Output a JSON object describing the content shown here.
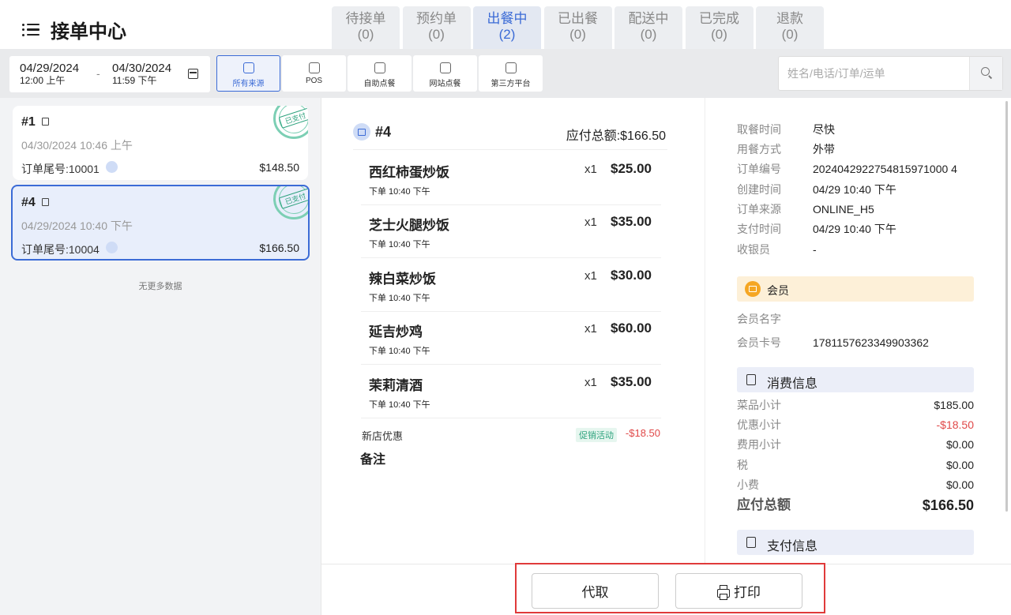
{
  "header": {
    "title": "接单中心",
    "tabs": [
      {
        "label": "待接单",
        "count": "(0)"
      },
      {
        "label": "预约单",
        "count": "(0)"
      },
      {
        "label": "出餐中",
        "count": "(2)"
      },
      {
        "label": "已出餐",
        "count": "(0)"
      },
      {
        "label": "配送中",
        "count": "(0)"
      },
      {
        "label": "已完成",
        "count": "(0)"
      },
      {
        "label": "退款",
        "count": "(0)"
      }
    ],
    "active_tab": "出餐中"
  },
  "filter": {
    "start_date": "04/29/2024",
    "start_time": "12:00 上午",
    "separator": "-",
    "end_date": "04/30/2024",
    "end_time": "11:59 下午",
    "sources": [
      "所有来源",
      "POS",
      "自助点餐",
      "网站点餐",
      "第三方平台"
    ],
    "active_source": "所有来源",
    "search_placeholder": "姓名/电话/订单/运单"
  },
  "orders": [
    {
      "num": "#1",
      "time": "04/30/2024 10:46 上午",
      "tail": "订单尾号:10001",
      "amount": "$148.50",
      "stamp": "已支付"
    },
    {
      "num": "#4",
      "time": "04/29/2024 10:40 下午",
      "tail": "订单尾号:10004",
      "amount": "$166.50",
      "stamp": "已支付"
    }
  ],
  "no_more": "无更多数据",
  "detail": {
    "num": "#4",
    "total": "应付总额:$166.50",
    "items": [
      {
        "name": "西红柿蛋炒饭",
        "time": "下单 10:40 下午",
        "qty": "x1",
        "price": "$25.00"
      },
      {
        "name": "芝士火腿炒饭",
        "time": "下单 10:40 下午",
        "qty": "x1",
        "price": "$35.00"
      },
      {
        "name": "辣白菜炒饭",
        "time": "下单 10:40 下午",
        "qty": "x1",
        "price": "$30.00"
      },
      {
        "name": "延吉炒鸡",
        "time": "下单 10:40 下午",
        "qty": "x1",
        "price": "$60.00"
      },
      {
        "name": "茉莉清酒",
        "time": "下单 10:40 下午",
        "qty": "x1",
        "price": "$35.00"
      }
    ],
    "promo_name": "新店优惠",
    "promo_tag": "促销活动",
    "promo_value": "-$18.50",
    "remark": "备注"
  },
  "info": {
    "fields": [
      {
        "k": "取餐时间",
        "v": "尽快"
      },
      {
        "k": "用餐方式",
        "v": "外带"
      },
      {
        "k": "订单编号",
        "v": "2024042922754815971000 4"
      },
      {
        "k": "创建时间",
        "v": "04/29 10:40 下午"
      },
      {
        "k": "订单来源",
        "v": "ONLINE_H5"
      },
      {
        "k": "支付时间",
        "v": "04/29 10:40 下午"
      },
      {
        "k": "收银员",
        "v": "-"
      }
    ],
    "member_title": "会员",
    "member_fields": [
      {
        "k": "会员名字",
        "v": ""
      },
      {
        "k": "会员卡号",
        "v": "1781157623349903362"
      }
    ],
    "consume_title": "消费信息",
    "consume_rows": [
      {
        "k": "菜品小计",
        "v": "$185.00"
      },
      {
        "k": "优惠小计",
        "v": "-$18.50"
      },
      {
        "k": "费用小计",
        "v": "$0.00"
      },
      {
        "k": "税",
        "v": "$0.00"
      },
      {
        "k": "小费",
        "v": "$0.00"
      }
    ],
    "payable_label": "应付总额",
    "payable_value": "$166.50",
    "pay_title": "支付信息"
  },
  "actions": {
    "pickup_label": "代取",
    "print_label": "打印"
  },
  "colors": {
    "accent": "#3b6bd6",
    "highlight_box": "#e03a3a",
    "discount": "#e04848",
    "paid_stamp": "#2ea37e"
  }
}
